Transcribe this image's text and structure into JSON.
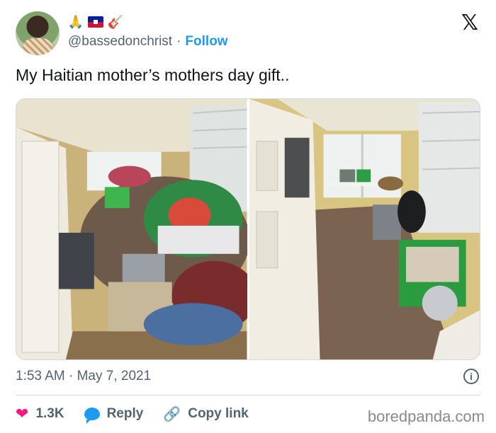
{
  "author": {
    "handle": "@bassedonchrist",
    "follow_label": "Follow",
    "separator": "·",
    "emoji": [
      "praying-hands",
      "haiti-flag",
      "guitar"
    ]
  },
  "platform_logo": "𝕏",
  "tweet": {
    "text": "My Haitian mother’s mothers day gift..",
    "images": [
      {
        "icon": "photo-cluttered-room"
      },
      {
        "icon": "photo-cleaned-room"
      }
    ]
  },
  "meta": {
    "time": "1:53 AM",
    "separator": "·",
    "date": "May 7, 2021",
    "info_glyph": "i"
  },
  "actions": {
    "likes": "1.3K",
    "reply_label": "Reply",
    "copy_link_label": "Copy link"
  },
  "watermark": "boredpanda.com",
  "colors": {
    "accent": "#1d9bf0",
    "like": "#f91880",
    "muted": "#536471",
    "text": "#0f1419"
  }
}
